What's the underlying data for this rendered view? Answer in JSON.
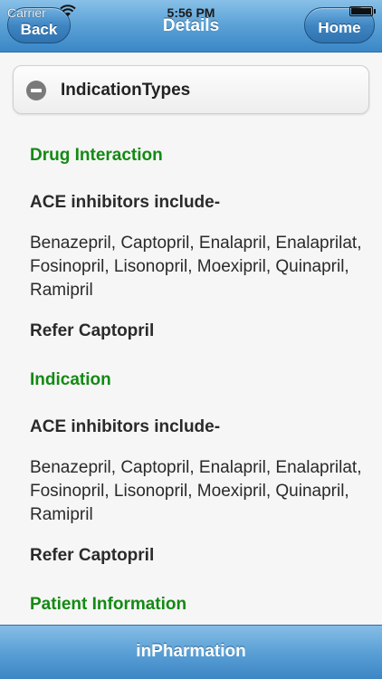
{
  "status_bar": {
    "carrier": "Carrier",
    "time": "5:56 PM"
  },
  "navbar": {
    "title": "Details",
    "back_label": "Back",
    "home_label": "Home"
  },
  "collapsible": {
    "label": "IndicationTypes",
    "icon": "minus-circle-icon"
  },
  "sections": [
    {
      "title": "Drug Interaction",
      "subhead": "ACE inhibitors include-",
      "body": "Benazepril, Captopril, Enalapril, Enalaprilat, Fosinopril, Lisonopril, Moexipril, Quinapril, Ramipril",
      "refer": "Refer Captopril"
    },
    {
      "title": "Indication",
      "subhead": "ACE inhibitors include-",
      "body": "Benazepril, Captopril, Enalapril, Enalaprilat, Fosinopril, Lisonopril, Moexipril, Quinapril, Ramipril",
      "refer": "Refer Captopril"
    },
    {
      "title": "Patient Information"
    }
  ],
  "footer": {
    "title": "inPharmation"
  },
  "colors": {
    "section_title": "#138a13",
    "bar_blue": "#5aa0d6"
  }
}
